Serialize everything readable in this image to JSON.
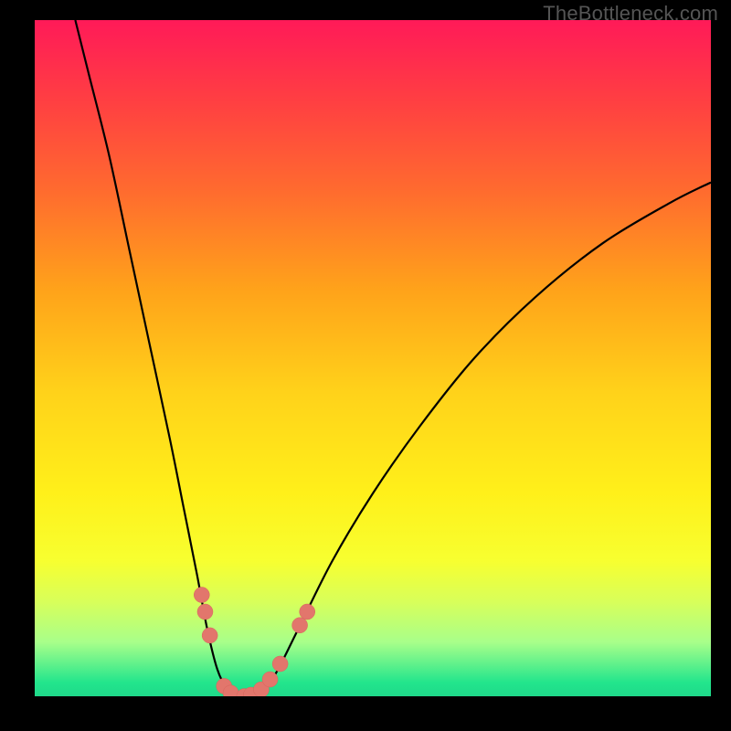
{
  "watermark": "TheBottleneck.com",
  "colors": {
    "curve": "#000000",
    "marker": "#e2766c",
    "marker_stroke": "#d8645b"
  },
  "chart_data": {
    "type": "line",
    "title": "",
    "xlabel": "",
    "ylabel": "",
    "xrange": [
      0,
      100
    ],
    "yrange": [
      0,
      100
    ],
    "grid": false,
    "legend": false,
    "curve": [
      {
        "x": 6.0,
        "y": 100.0
      },
      {
        "x": 8.0,
        "y": 92.0
      },
      {
        "x": 11.0,
        "y": 80.0
      },
      {
        "x": 14.0,
        "y": 66.0
      },
      {
        "x": 17.0,
        "y": 52.0
      },
      {
        "x": 20.0,
        "y": 38.0
      },
      {
        "x": 22.0,
        "y": 28.0
      },
      {
        "x": 24.0,
        "y": 18.0
      },
      {
        "x": 25.5,
        "y": 10.0
      },
      {
        "x": 27.0,
        "y": 4.0
      },
      {
        "x": 28.5,
        "y": 1.0
      },
      {
        "x": 30.0,
        "y": 0.0
      },
      {
        "x": 32.0,
        "y": 0.0
      },
      {
        "x": 34.0,
        "y": 1.0
      },
      {
        "x": 36.0,
        "y": 4.0
      },
      {
        "x": 39.0,
        "y": 10.0
      },
      {
        "x": 44.0,
        "y": 20.0
      },
      {
        "x": 50.0,
        "y": 30.0
      },
      {
        "x": 57.0,
        "y": 40.0
      },
      {
        "x": 65.0,
        "y": 50.0
      },
      {
        "x": 74.0,
        "y": 59.0
      },
      {
        "x": 84.0,
        "y": 67.0
      },
      {
        "x": 94.0,
        "y": 73.0
      },
      {
        "x": 100.0,
        "y": 76.0
      }
    ],
    "markers": [
      {
        "x": 24.7,
        "y": 15.0
      },
      {
        "x": 25.2,
        "y": 12.5
      },
      {
        "x": 25.9,
        "y": 9.0
      },
      {
        "x": 28.0,
        "y": 1.5
      },
      {
        "x": 29.0,
        "y": 0.5
      },
      {
        "x": 31.0,
        "y": 0.0
      },
      {
        "x": 32.0,
        "y": 0.2
      },
      {
        "x": 33.5,
        "y": 1.0
      },
      {
        "x": 34.8,
        "y": 2.5
      },
      {
        "x": 36.3,
        "y": 4.8
      },
      {
        "x": 39.2,
        "y": 10.5
      },
      {
        "x": 40.3,
        "y": 12.5
      }
    ]
  }
}
